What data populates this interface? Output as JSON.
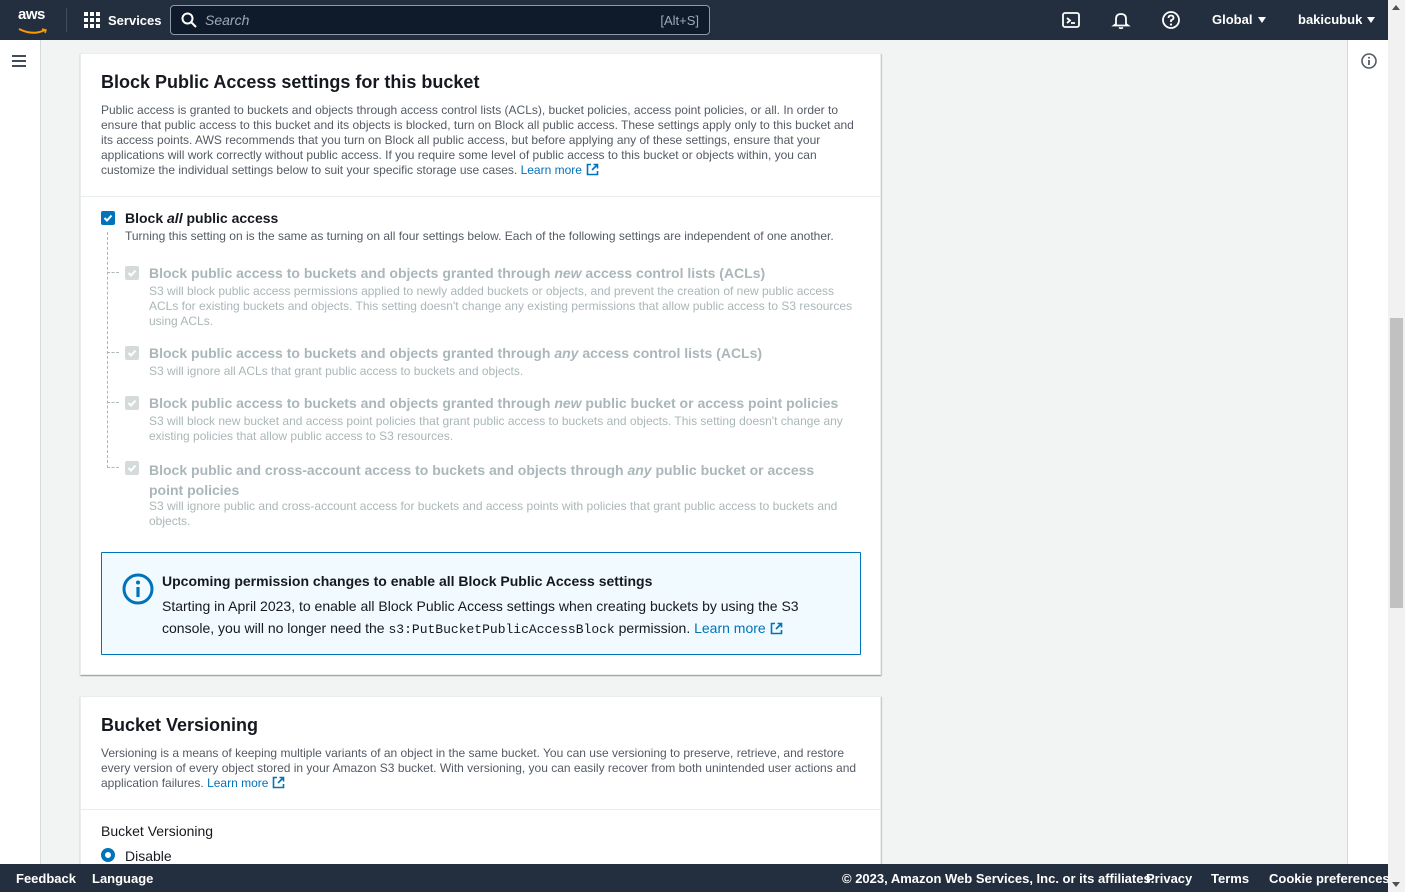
{
  "nav": {
    "logo_text": "aws",
    "services_label": "Services",
    "search_placeholder": "Search",
    "search_shortcut": "[Alt+S]",
    "region_label": "Global",
    "user_label": "bakicubuk"
  },
  "block_public_access": {
    "title": "Block Public Access settings for this bucket",
    "description": "Public access is granted to buckets and objects through access control lists (ACLs), bucket policies, access point policies, or all. In order to ensure that public access to this bucket and its objects is blocked, turn on Block all public access. These settings apply only to this bucket and its access points. AWS recommends that you turn on Block all public access, but before applying any of these settings, ensure that your applications will work correctly without public access. If you require some level of public access to this bucket or objects within, you can customize the individual settings below to suit your specific storage use cases.",
    "learn_more": "Learn more",
    "block_all": {
      "label_pre": "Block ",
      "label_em": "all",
      "label_post": " public access",
      "description": "Turning this setting on is the same as turning on all four settings below. Each of the following settings are independent of one another.",
      "checked": true
    },
    "options": [
      {
        "label_pre": "Block public access to buckets and objects granted through ",
        "label_em": "new",
        "label_post": " access control lists (ACLs)",
        "description": "S3 will block public access permissions applied to newly added buckets or objects, and prevent the creation of new public access ACLs for existing buckets and objects. This setting doesn't change any existing permissions that allow public access to S3 resources using ACLs.",
        "checked": true
      },
      {
        "label_pre": "Block public access to buckets and objects granted through ",
        "label_em": "any",
        "label_post": " access control lists (ACLs)",
        "description": "S3 will ignore all ACLs that grant public access to buckets and objects.",
        "checked": true
      },
      {
        "label_pre": "Block public access to buckets and objects granted through ",
        "label_em": "new",
        "label_post": " public bucket or access point policies",
        "description": "S3 will block new bucket and access point policies that grant public access to buckets and objects. This setting doesn't change any existing policies that allow public access to S3 resources.",
        "checked": true
      },
      {
        "label_pre": "Block public and cross-account access to buckets and objects through ",
        "label_em": "any",
        "label_post": " public bucket or access point policies",
        "description": "S3 will ignore public and cross-account access for buckets and access points with policies that grant public access to buckets and objects.",
        "checked": true
      }
    ],
    "alert": {
      "title": "Upcoming permission changes to enable all Block Public Access settings",
      "body_pre": "Starting in April 2023, to enable all Block Public Access settings when creating buckets by using the S3 console, you will no longer need the ",
      "body_code": "s3:PutBucketPublicAccessBlock",
      "body_post": " permission.",
      "learn_more": "Learn more"
    }
  },
  "versioning": {
    "title": "Bucket Versioning",
    "description": "Versioning is a means of keeping multiple variants of an object in the same bucket. You can use versioning to preserve, retrieve, and restore every version of every object stored in your Amazon S3 bucket. With versioning, you can easily recover from both unintended user actions and application failures.",
    "learn_more": "Learn more",
    "field_label": "Bucket Versioning",
    "option_disable": "Disable",
    "selected": "Disable"
  },
  "footer": {
    "feedback": "Feedback",
    "language": "Language",
    "copyright": "© 2023, Amazon Web Services, Inc. or its affiliates.",
    "privacy": "Privacy",
    "terms": "Terms",
    "cookie": "Cookie preferences"
  },
  "watermark": "bakicubuk",
  "colors": {
    "nav_bg": "#232f3e",
    "link": "#0073bb",
    "checkbox_checked": "#0073bb",
    "checkbox_disabled": "#d5dbdb",
    "alert_bg": "#f1faff"
  }
}
